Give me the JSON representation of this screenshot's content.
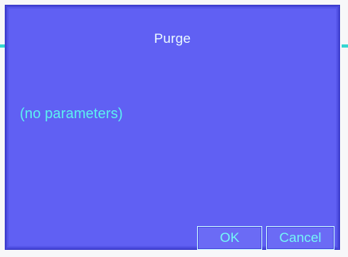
{
  "dialog": {
    "title": "Purge",
    "body_text": "(no parameters)",
    "buttons": {
      "ok": "OK",
      "cancel": "Cancel"
    }
  },
  "colors": {
    "dialog_background": "#6060f3",
    "title_text": "#ecfbff",
    "accent_text": "#5cf3f0",
    "button_border": "#c9f6ff"
  }
}
